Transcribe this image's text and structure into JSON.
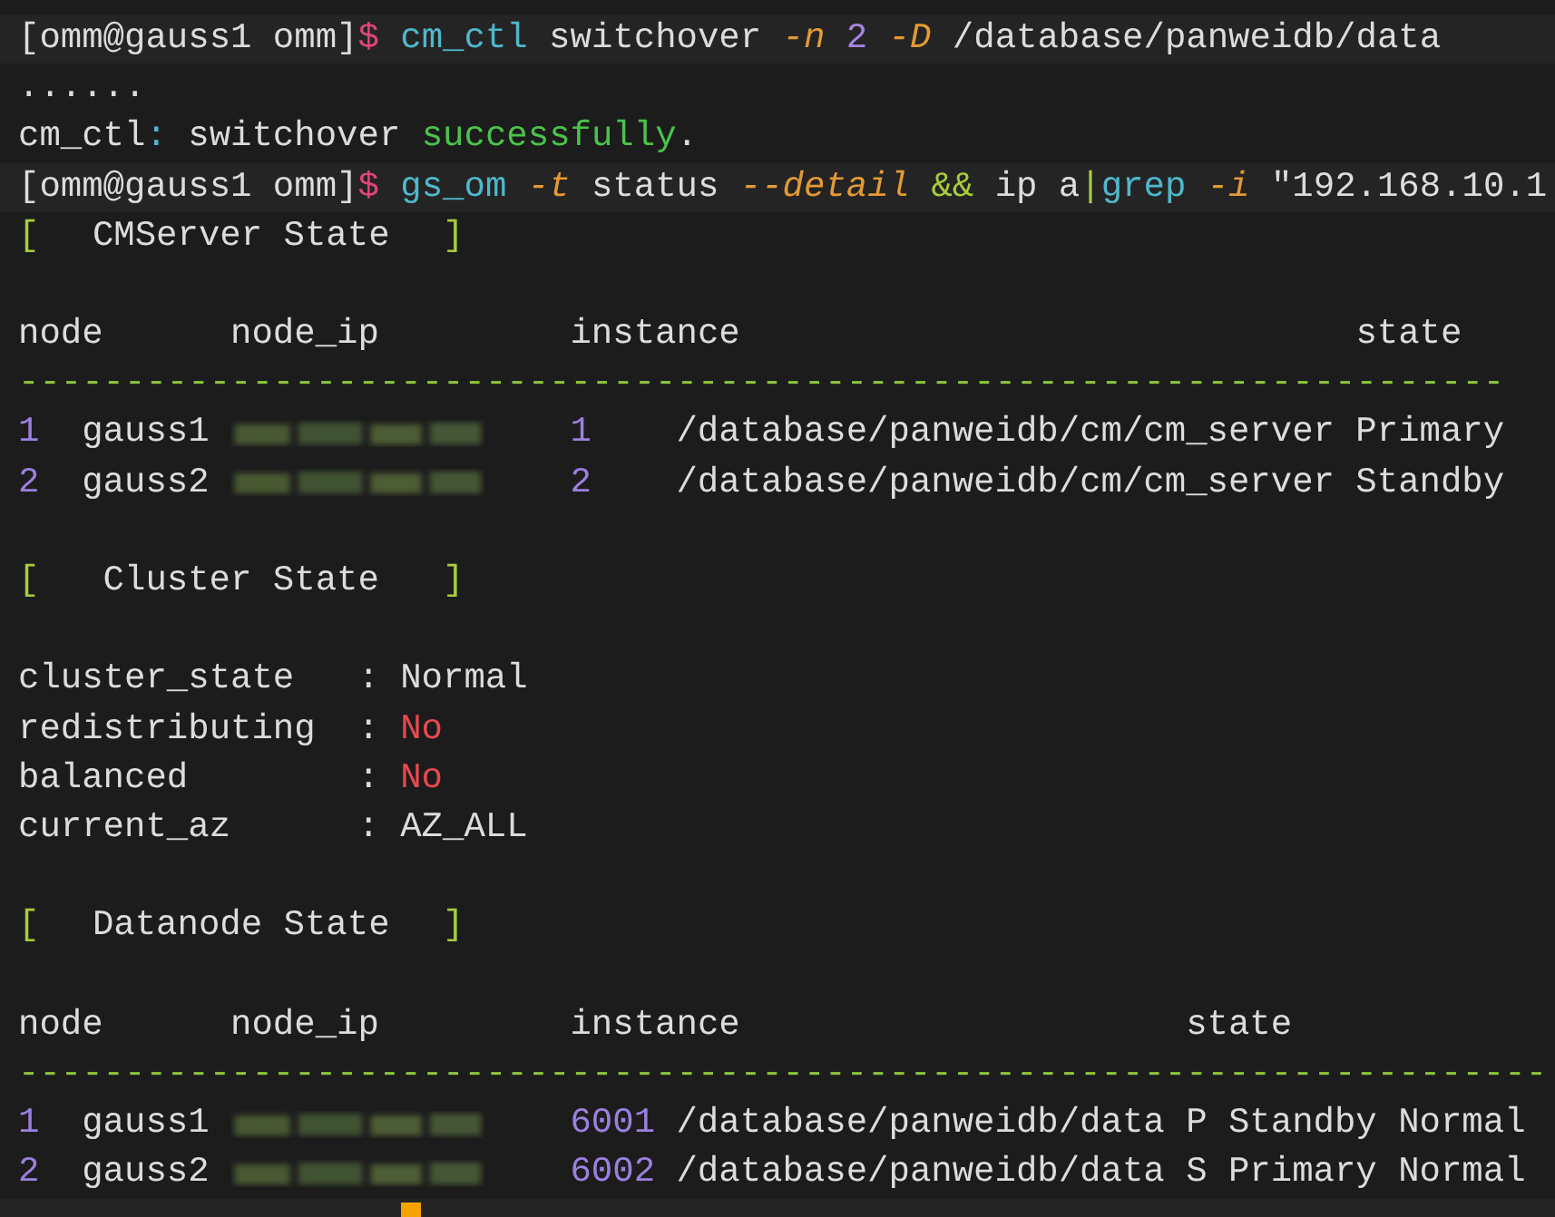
{
  "terminal": {
    "lines": [
      {
        "kind": "input",
        "segments": [
          {
            "kind": "prompt",
            "text": "[omm@gauss1 omm]"
          },
          {
            "kind": "sigil",
            "text": "$"
          },
          {
            "kind": "command",
            "text": " cm_ctl"
          },
          {
            "kind": "plain",
            "text": " switchover"
          },
          {
            "kind": "option",
            "text": " -n"
          },
          {
            "kind": "number",
            "text": " 2"
          },
          {
            "kind": "option",
            "text": " -D"
          },
          {
            "kind": "plain",
            "text": " /database/panweidb/data"
          }
        ]
      },
      {
        "kind": "output",
        "segments": [
          {
            "kind": "plain",
            "text": "......"
          }
        ]
      },
      {
        "kind": "output",
        "segments": [
          {
            "kind": "plain",
            "text": "cm_ctl"
          },
          {
            "kind": "punct",
            "text": ":"
          },
          {
            "kind": "plain",
            "text": " switchover"
          },
          {
            "kind": "success",
            "text": " successfully"
          },
          {
            "kind": "plain",
            "text": "."
          }
        ]
      },
      {
        "kind": "input",
        "segments": [
          {
            "kind": "prompt",
            "text": "[omm@gauss1 omm]"
          },
          {
            "kind": "sigil",
            "text": "$"
          },
          {
            "kind": "command",
            "text": " gs_om"
          },
          {
            "kind": "option",
            "text": " -t"
          },
          {
            "kind": "plain",
            "text": " status"
          },
          {
            "kind": "option",
            "text": " --detail"
          },
          {
            "kind": "operator",
            "text": " &&"
          },
          {
            "kind": "plain",
            "text": " ip a"
          },
          {
            "kind": "operator",
            "text": "|"
          },
          {
            "kind": "command",
            "text": "grep"
          },
          {
            "kind": "option",
            "text": " -i"
          },
          {
            "kind": "plain",
            "text": " \"192.168.10.1"
          }
        ]
      }
    ],
    "sections": [
      {
        "kind": "cm_table",
        "open": "[",
        "title": "CMServer State",
        "close": "]",
        "columns": [
          "node",
          "node_ip",
          "instance",
          "state"
        ],
        "rule": "----------------------------------------------------------------------",
        "rows": [
          {
            "index": "1",
            "node": "gauss1",
            "instance": "1",
            "path": "/database/panweidb/cm/cm_server",
            "state": "Primary"
          },
          {
            "index": "2",
            "node": "gauss2",
            "instance": "2",
            "path": "/database/panweidb/cm/cm_server",
            "state": "Standby"
          }
        ]
      },
      {
        "kind": "key_values",
        "open": "[",
        "title": "Cluster State",
        "close": "]",
        "items": [
          {
            "key": "cluster_state",
            "sep": ":",
            "value": "Normal",
            "kind": "ok"
          },
          {
            "key": "redistributing",
            "sep": ":",
            "value": "No",
            "kind": "bad"
          },
          {
            "key": "balanced",
            "sep": ":",
            "value": "No",
            "kind": "bad"
          },
          {
            "key": "current_az",
            "sep": ":",
            "value": "AZ_ALL",
            "kind": "ok"
          }
        ]
      },
      {
        "kind": "dn_table",
        "open": "[",
        "title": "Datanode State",
        "close": "]",
        "columns": [
          "node",
          "node_ip",
          "instance",
          "state"
        ],
        "rule": "------------------------------------------------------------------------",
        "rows": [
          {
            "index": "1",
            "node": "gauss1",
            "instance": "6001",
            "path": "/database/panweidb/data",
            "state": "P Standby Normal"
          },
          {
            "index": "2",
            "node": "gauss2",
            "instance": "6002",
            "path": "/database/panweidb/data",
            "state": "S Primary Normal"
          }
        ]
      }
    ],
    "cursor": true
  }
}
